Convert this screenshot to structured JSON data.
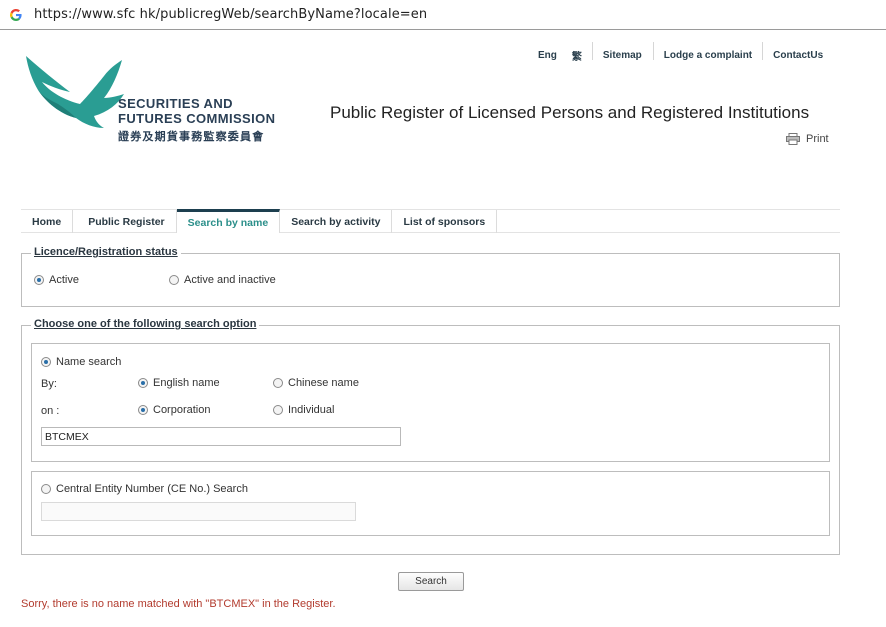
{
  "browser": {
    "url": "https://www.sfc hk/publicregWeb/searchByName?locale=en"
  },
  "header": {
    "links": [
      {
        "label": "Eng"
      },
      {
        "label": "繁"
      },
      {
        "label": "Sitemap"
      },
      {
        "label": "Lodge a complaint"
      },
      {
        "label": "ContactUs"
      }
    ],
    "logo_line1": "SECURITIES AND",
    "logo_line2": "FUTURES COMMISSION",
    "logo_chinese": "證券及期貨事務監察委員會",
    "page_title": "Public Register of Licensed Persons and Registered Institutions",
    "print_label": "Print"
  },
  "tabs": [
    {
      "label": "Home",
      "active": false
    },
    {
      "label": "Public Register",
      "active": false
    },
    {
      "label": "Search by name",
      "active": true
    },
    {
      "label": "Search by activity",
      "active": false
    },
    {
      "label": "List of sponsors",
      "active": false
    }
  ],
  "status": {
    "legend": "Licence/Registration status",
    "options": [
      {
        "label": "Active",
        "checked": true
      },
      {
        "label": "Active and inactive",
        "checked": false
      }
    ]
  },
  "search_option": {
    "legend": "Choose one of the following search option",
    "name_search": {
      "label": "Name search",
      "checked": true,
      "by_label": "By:",
      "by_options": [
        {
          "label": "English name",
          "checked": true
        },
        {
          "label": "Chinese name",
          "checked": false
        }
      ],
      "on_label": "on :",
      "on_options": [
        {
          "label": "Corporation",
          "checked": true
        },
        {
          "label": "Individual",
          "checked": false
        }
      ],
      "value": "BTCMEX"
    },
    "ce_search": {
      "label": "Central Entity Number (CE No.) Search",
      "checked": false,
      "value": ""
    }
  },
  "search_button": "Search",
  "error_message": "Sorry, there is no name matched with \"BTCMEX\" in the Register.",
  "colors": {
    "brand_teal": "#2a9d93",
    "active_tab": "#2b8f8a",
    "error": "#b23b2e"
  }
}
